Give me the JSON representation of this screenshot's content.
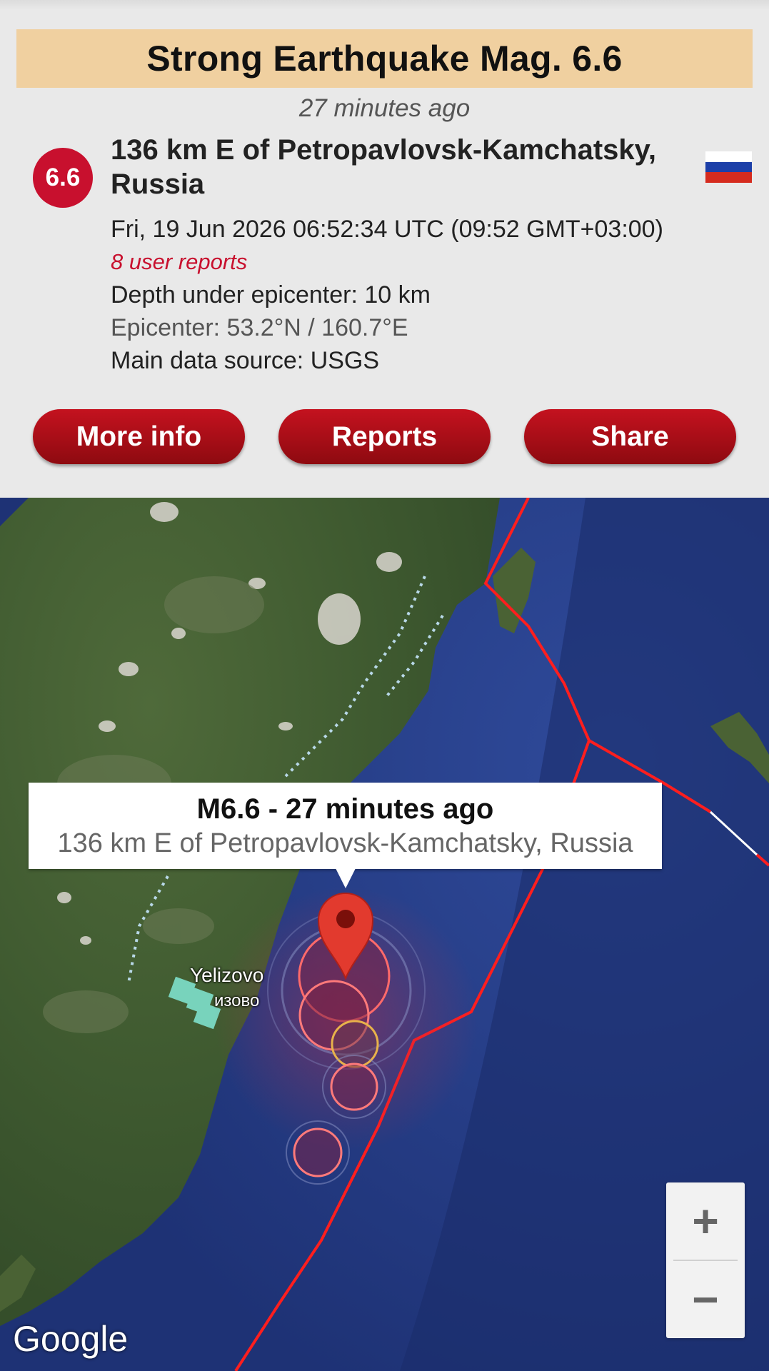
{
  "header": {
    "title": "Strong Earthquake Mag. 6.6",
    "time_ago": "27 minutes ago"
  },
  "event": {
    "magnitude": "6.6",
    "location": "136 km E of Petropavlovsk-Kamchatsky, Russia",
    "datetime": "Fri, 19 Jun 2026 06:52:34 UTC (09:52 GMT+03:00)",
    "user_reports": "8 user reports",
    "depth": "Depth under epicenter: 10 km",
    "epicenter": "Epicenter: 53.2°N / 160.7°E",
    "source": "Main data source: USGS",
    "country_flag": "russia-flag",
    "colors": {
      "accent": "#c8102e",
      "banner": "#f0d0a0"
    }
  },
  "buttons": {
    "more_info": "More info",
    "reports": "Reports",
    "share": "Share"
  },
  "map": {
    "callout_title": "M6.6  -  27 minutes ago",
    "callout_subtitle": "136 km E of Petropavlovsk-Kamchatsky, Russia",
    "town_label": "Yelizovo",
    "town_label_local": "изово",
    "zoom_in": "+",
    "zoom_out": "−",
    "attribution": "Google"
  }
}
